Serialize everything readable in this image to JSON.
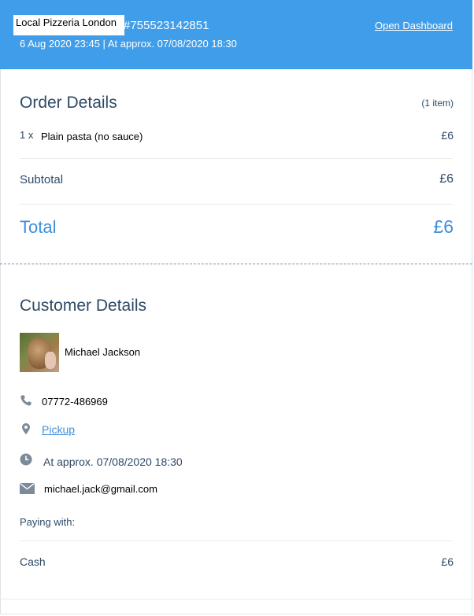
{
  "header": {
    "shop_name": "Local Pizzeria London",
    "order_number": "#755523142851",
    "open_dashboard": "Open Dashboard",
    "datetime_line": "6 Aug 2020 23:45 | At approx. 07/08/2020 18:30"
  },
  "order_details": {
    "title": "Order Details",
    "item_count": "(1 item)",
    "items": [
      {
        "qty": "1 x",
        "name": "Plain pasta (no sauce)",
        "price": "£6"
      }
    ],
    "subtotal_label": "Subtotal",
    "subtotal_value": "£6",
    "total_label": "Total",
    "total_value": "£6"
  },
  "customer": {
    "title": "Customer Details",
    "name": "Michael Jackson",
    "phone": "07772-486969",
    "delivery_method": "Pickup",
    "time": "At approx. 07/08/2020 18:30",
    "email": "michael.jack@gmail.com",
    "paying_with_label": "Paying with:",
    "payment_method": "Cash",
    "payment_amount": "£6"
  },
  "icons": [
    "phone-icon",
    "location-pin-icon",
    "clock-icon",
    "envelope-icon"
  ],
  "colors": {
    "header_bg": "#3f9de9",
    "accent": "#3f8fd8",
    "text": "#2d4a66"
  }
}
